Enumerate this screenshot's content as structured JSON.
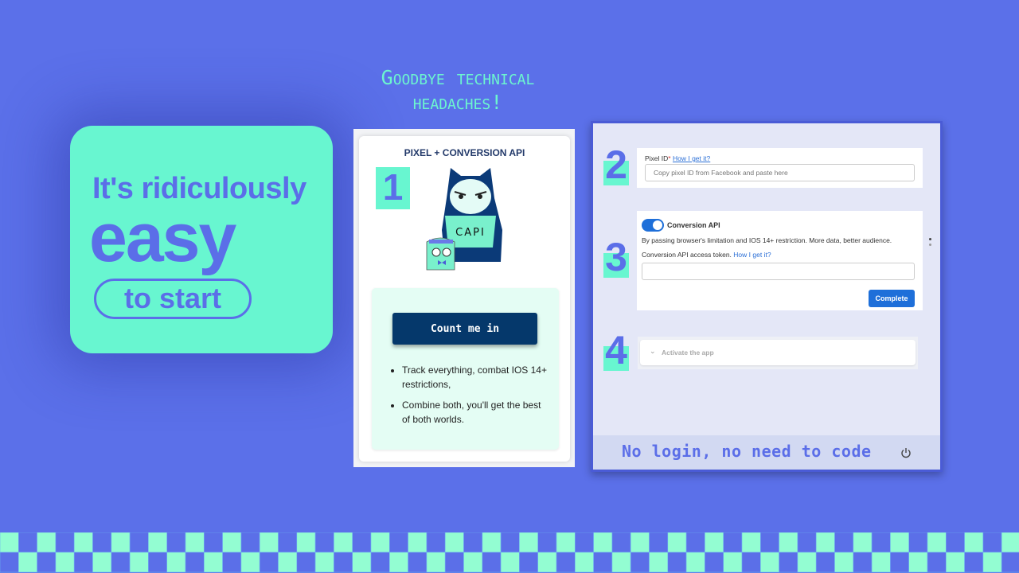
{
  "hero": {
    "line1": "It's ridiculously",
    "line2": "easy",
    "line3": "to start"
  },
  "headline": {
    "line1": "Goodbye technical",
    "line2": "headaches!"
  },
  "step1": {
    "number": "1",
    "title": "PIXEL + CONVERSION API",
    "mascot_text": "CAPI",
    "cta_label": "Count me in",
    "bullets": [
      "Track everything, combat IOS 14+ restrictions,",
      "Combine both, you'll get the best of both worlds."
    ]
  },
  "step2": {
    "number": "2",
    "label": "Pixel ID",
    "required": "*",
    "help_link": "How I get it?",
    "placeholder": "Copy pixel ID from Facebook and paste here",
    "value": ""
  },
  "step3": {
    "number": "3",
    "toggle_label": "Conversion API",
    "toggle_on": true,
    "description": "By passing browser's limitation and IOS 14+ restriction. More data, better audience.",
    "token_label": "Conversion API access token.",
    "help_link": "How I get it?",
    "token_value": "",
    "complete_label": "Complete"
  },
  "step4": {
    "number": "4",
    "label": "Activate the app"
  },
  "footer": {
    "text": "No login, no need to code",
    "icon": "power-icon"
  },
  "colors": {
    "background": "#5b70e9",
    "mint": "#68f6d0",
    "accent": "#5b6ee8",
    "navy": "#05386b",
    "button_blue": "#1e6fd9"
  }
}
